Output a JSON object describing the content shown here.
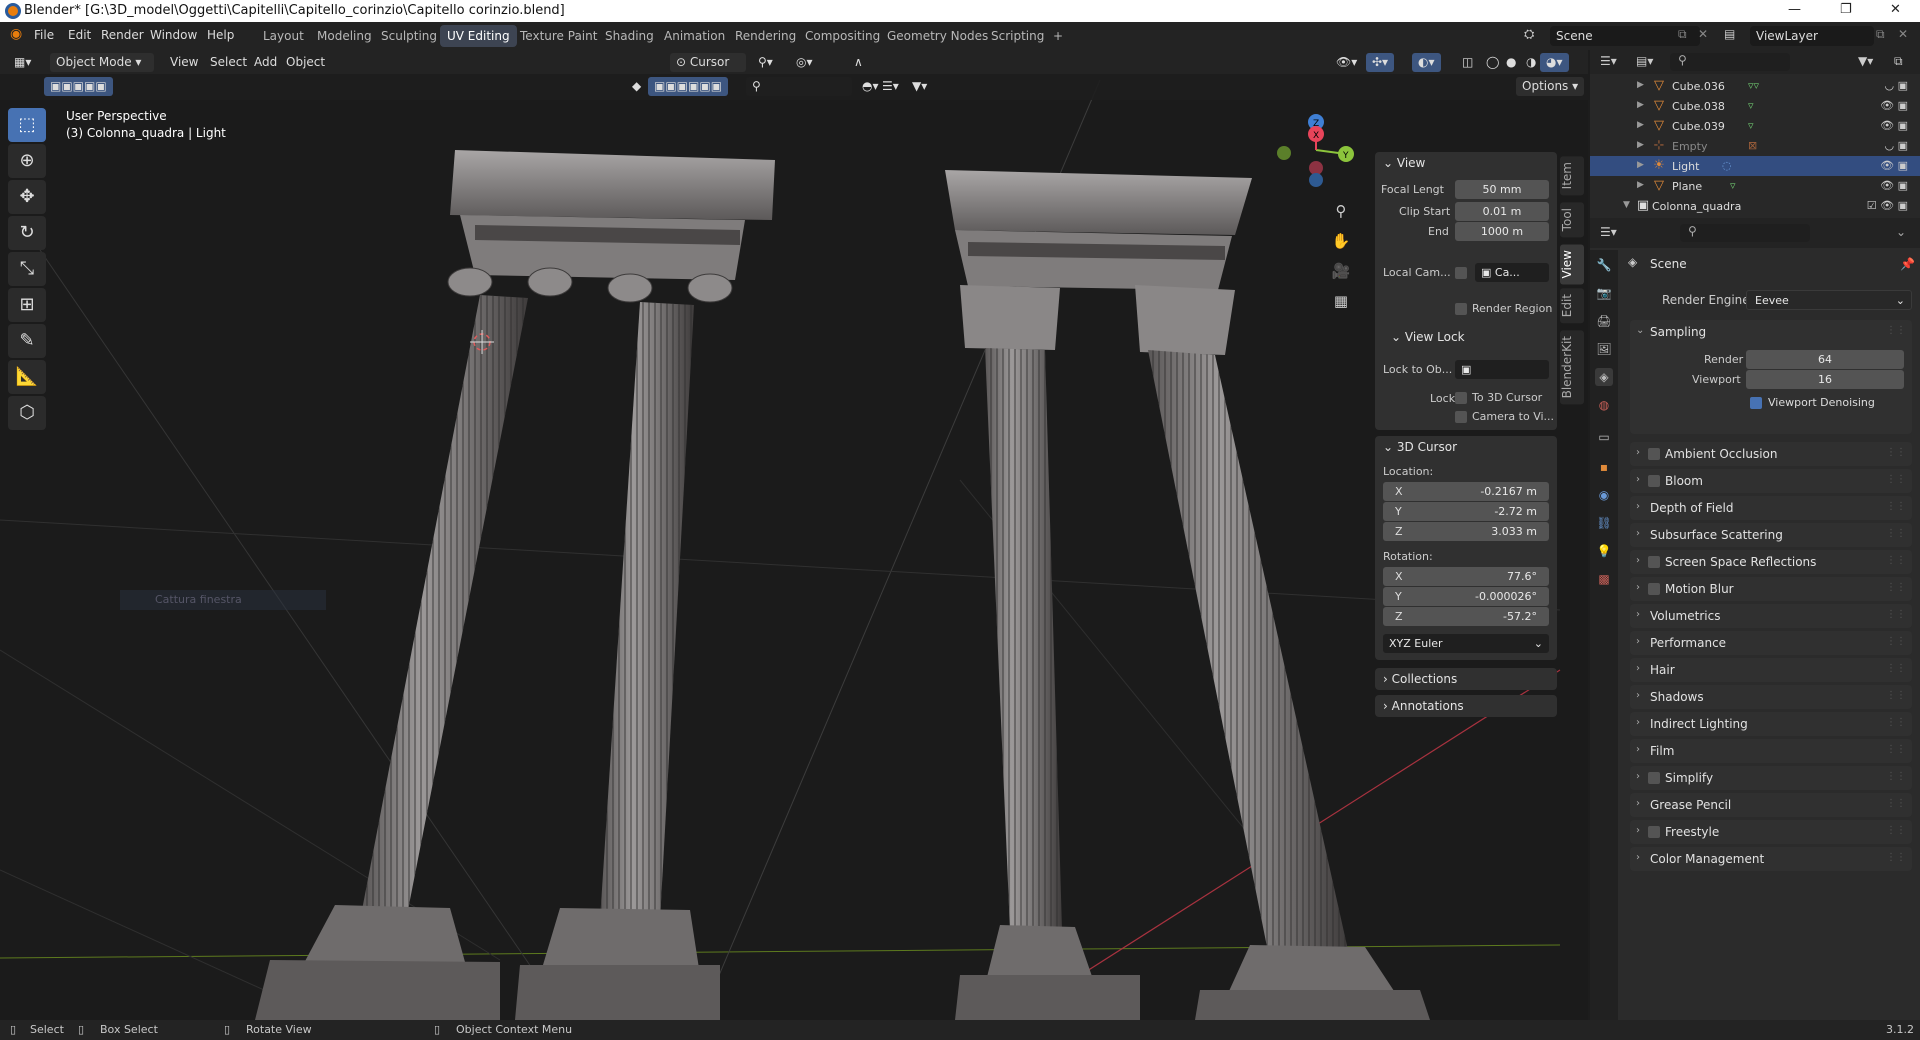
{
  "window": {
    "title": "Blender* [G:\\3D_model\\Oggetti\\Capitelli\\Capitello_corinzio\\Capitello corinzio.blend]",
    "controls": [
      "—",
      "❐",
      "✕"
    ]
  },
  "menu": [
    "File",
    "Edit",
    "Render",
    "Window",
    "Help"
  ],
  "workspaces": [
    "Layout",
    "Modeling",
    "Sculpting",
    "UV Editing",
    "Texture Paint",
    "Shading",
    "Animation",
    "Rendering",
    "Compositing",
    "Geometry Nodes",
    "Scripting",
    "+"
  ],
  "active_workspace": "UV Editing",
  "scene_name": "Scene",
  "view_layer": "ViewLayer",
  "viewport_header": {
    "mode": "Object Mode",
    "menus": [
      "View",
      "Select",
      "Add",
      "Object"
    ],
    "transform_pivot": "Cursor",
    "options": "Options"
  },
  "viewport": {
    "perspective": "User Perspective",
    "object_info": "(3) Colonna_quadra | Light",
    "faded_hint": "Cattura finestra"
  },
  "npanel": {
    "tabs": [
      "Item",
      "Tool",
      "View",
      "Edit",
      "BlenderKit"
    ],
    "active_tab": "View",
    "view": {
      "header": "View",
      "focal_label": "Focal Lengt",
      "focal_value": "50 mm",
      "clip_start_label": "Clip Start",
      "clip_start_value": "0.01 m",
      "end_label": "End",
      "end_value": "1000 m",
      "local_cam_label": "Local Cam...",
      "local_cam_value": "Ca...",
      "render_region": "Render Region"
    },
    "view_lock": {
      "header": "View Lock",
      "lock_to_obj": "Lock to Ob...",
      "lock_label": "Lock",
      "to_cursor": "To 3D Cursor",
      "camera_to_view": "Camera to Vi..."
    },
    "cursor": {
      "header": "3D Cursor",
      "location_label": "Location:",
      "loc": [
        {
          "k": "X",
          "v": "-0.2167 m"
        },
        {
          "k": "Y",
          "v": "-2.72 m"
        },
        {
          "k": "Z",
          "v": "3.033 m"
        }
      ],
      "rotation_label": "Rotation:",
      "rot": [
        {
          "k": "X",
          "v": "77.6°"
        },
        {
          "k": "Y",
          "v": "-0.000026°"
        },
        {
          "k": "Z",
          "v": "-57.2°"
        }
      ],
      "rotation_mode": "XYZ Euler"
    },
    "collections": "Collections",
    "annotations": "Annotations"
  },
  "outliner": {
    "items": [
      {
        "name": "Cube.036",
        "selected": false
      },
      {
        "name": "Cube.038",
        "selected": false
      },
      {
        "name": "Cube.039",
        "selected": false
      },
      {
        "name": "Empty",
        "selected": false
      },
      {
        "name": "Light",
        "selected": true
      },
      {
        "name": "Plane",
        "selected": false
      },
      {
        "name": "Colonna_quadra",
        "selected": false
      }
    ]
  },
  "properties": {
    "context": "Scene",
    "render_engine_label": "Render Engine",
    "render_engine": "Eevee",
    "sampling": {
      "header": "Sampling",
      "render_label": "Render",
      "render_value": "64",
      "viewport_label": "Viewport",
      "viewport_value": "16",
      "denoise_label": "Viewport Denoising"
    },
    "sections": [
      {
        "label": "Ambient Occlusion",
        "checkbox": true
      },
      {
        "label": "Bloom",
        "checkbox": true
      },
      {
        "label": "Depth of Field",
        "checkbox": false
      },
      {
        "label": "Subsurface Scattering",
        "checkbox": false
      },
      {
        "label": "Screen Space Reflections",
        "checkbox": true
      },
      {
        "label": "Motion Blur",
        "checkbox": true
      },
      {
        "label": "Volumetrics",
        "checkbox": false
      },
      {
        "label": "Performance",
        "checkbox": false
      },
      {
        "label": "Hair",
        "checkbox": false
      },
      {
        "label": "Shadows",
        "checkbox": false
      },
      {
        "label": "Indirect Lighting",
        "checkbox": false
      },
      {
        "label": "Film",
        "checkbox": false
      },
      {
        "label": "Simplify",
        "checkbox": true
      },
      {
        "label": "Grease Pencil",
        "checkbox": false
      },
      {
        "label": "Freestyle",
        "checkbox": true
      },
      {
        "label": "Color Management",
        "checkbox": false
      }
    ]
  },
  "statusbar": {
    "select": "Select",
    "box_select": "Box Select",
    "rotate_view": "Rotate View",
    "context_menu": "Object Context Menu",
    "version": "3.1.2"
  },
  "colors": {
    "accent": "#4772b3",
    "selected_row": "#334d80",
    "x_axis": "#e8445a",
    "y_axis": "#8cc43c",
    "z_axis": "#3f7fd4"
  }
}
